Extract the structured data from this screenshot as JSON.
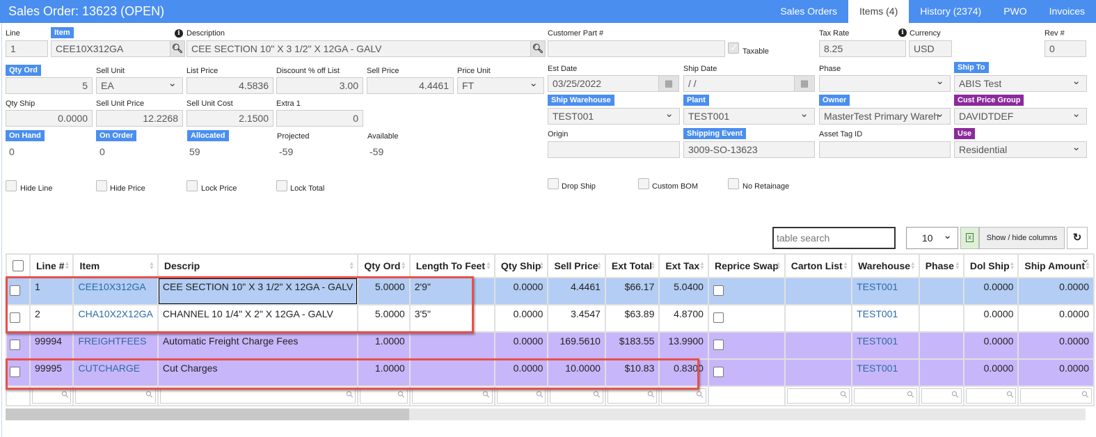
{
  "header": {
    "title": "Sales Order: 13623 (OPEN)",
    "tabs": [
      {
        "label": "Sales Orders",
        "active": false
      },
      {
        "label": "Items (4)",
        "active": true
      },
      {
        "label": "History (2374)",
        "active": false
      },
      {
        "label": "PWO",
        "active": false
      },
      {
        "label": "Invoices",
        "active": false
      }
    ]
  },
  "form": {
    "line": {
      "label": "Line",
      "value": "1"
    },
    "item": {
      "label": "Item",
      "value": "CEE10X312GA"
    },
    "description": {
      "label": "Description",
      "value": "CEE SECTION  10\" X 3 1/2\" X 12GA - GALV"
    },
    "customer_part": {
      "label": "Customer Part #",
      "value": ""
    },
    "taxable": {
      "label": "Taxable",
      "checked": true
    },
    "tax_rate": {
      "label": "Tax Rate",
      "value": "8.25"
    },
    "currency": {
      "label": "Currency",
      "value": "USD"
    },
    "rev": {
      "label": "Rev #",
      "value": "0"
    },
    "qty_ord": {
      "label": "Qty Ord",
      "value": "5"
    },
    "sell_unit": {
      "label": "Sell Unit",
      "value": "EA"
    },
    "list_price": {
      "label": "List Price",
      "value": "4.5836"
    },
    "discount": {
      "label": "Discount % off List",
      "value": "3.00"
    },
    "sell_price": {
      "label": "Sell Price",
      "value": "4.4461"
    },
    "price_unit": {
      "label": "Price Unit",
      "value": "FT"
    },
    "est_date": {
      "label": "Est Date",
      "value": "03/25/2022"
    },
    "ship_date": {
      "label": "Ship Date",
      "value": " /  /"
    },
    "phase": {
      "label": "Phase",
      "value": ""
    },
    "ship_to": {
      "label": "Ship To",
      "value": "ABIS Test"
    },
    "qty_ship": {
      "label": "Qty Ship",
      "value": "0.0000"
    },
    "sell_unit_price": {
      "label": "Sell Unit Price",
      "value": "12.2268"
    },
    "sell_unit_cost": {
      "label": "Sell Unit Cost",
      "value": "2.1500"
    },
    "extra1": {
      "label": "Extra 1",
      "value": "0"
    },
    "ship_warehouse": {
      "label": "Ship Warehouse",
      "value": "TEST001"
    },
    "plant": {
      "label": "Plant",
      "value": "TEST001"
    },
    "owner": {
      "label": "Owner",
      "value": "MasterTest Primary Wareh"
    },
    "cust_price_group": {
      "label": "Cust Price Group",
      "value": "DAVIDTDEF"
    },
    "on_hand": {
      "label": "On Hand",
      "value": "0"
    },
    "on_order": {
      "label": "On Order",
      "value": "0"
    },
    "allocated": {
      "label": "Allocated",
      "value": "59"
    },
    "projected": {
      "label": "Projected",
      "value": "-59"
    },
    "available": {
      "label": "Available",
      "value": "-59"
    },
    "origin": {
      "label": "Origin",
      "value": ""
    },
    "shipping_event": {
      "label": "Shipping Event",
      "value": "3009-SO-13623"
    },
    "asset_tag": {
      "label": "Asset Tag ID",
      "value": ""
    },
    "use": {
      "label": "Use",
      "value": "Residential"
    },
    "checkboxes": [
      {
        "label": "Hide Line",
        "checked": false
      },
      {
        "label": "Hide Price",
        "checked": false
      },
      {
        "label": "Lock Price",
        "checked": false
      },
      {
        "label": "Lock Total",
        "checked": false
      },
      {
        "label": "Drop Ship",
        "checked": false
      },
      {
        "label": "Custom BOM",
        "checked": false
      },
      {
        "label": "No Retainage",
        "checked": false
      }
    ]
  },
  "table_tools": {
    "search_placeholder": "table search",
    "page_size": "10",
    "excel_icon": "x",
    "show_hide_label": "Show / hide columns",
    "reset_icon": "↻"
  },
  "table": {
    "columns": [
      "Line #",
      "Item",
      "Descrip",
      "Qty Ord",
      "Length To Feet",
      "Qty Ship",
      "Sell Price",
      "Ext Total",
      "Ext Tax",
      "Reprice Swap",
      "Carton List",
      "Warehouse",
      "Phase",
      "Dol Ship",
      "Ship Amount"
    ],
    "rows": [
      {
        "line": "1",
        "item": "CEE10X312GA",
        "descrip": "CEE SECTION 10\" X 3 1/2\" X 12GA - GALV",
        "qty_ord": "5.0000",
        "length": "2'9\"",
        "qty_ship": "0.0000",
        "sell_price": "4.4461",
        "ext_total": "$66.17",
        "ext_tax": "5.0400",
        "carton": "",
        "warehouse": "TEST001",
        "phase": "",
        "dol_ship": "0.0000",
        "ship_amount": "0.0000",
        "style": "sel"
      },
      {
        "line": "2",
        "item": "CHA10X2X12GA",
        "descrip": "CHANNEL 10 1/4\" X 2\" X 12GA - GALV",
        "qty_ord": "5.0000",
        "length": "3'5\"",
        "qty_ship": "0.0000",
        "sell_price": "3.4547",
        "ext_total": "$63.89",
        "ext_tax": "4.8700",
        "carton": "",
        "warehouse": "TEST001",
        "phase": "",
        "dol_ship": "0.0000",
        "ship_amount": "0.0000",
        "style": "plain"
      },
      {
        "line": "99994",
        "item": "FREIGHTFEES",
        "descrip": "Automatic Freight Charge Fees",
        "qty_ord": "1.0000",
        "length": "",
        "qty_ship": "0.0000",
        "sell_price": "169.5610",
        "ext_total": "$183.55",
        "ext_tax": "13.9900",
        "carton": "",
        "warehouse": "TEST001",
        "phase": "",
        "dol_ship": "0.0000",
        "ship_amount": "0.0000",
        "style": "purple"
      },
      {
        "line": "99995",
        "item": "CUTCHARGE",
        "descrip": "Cut Charges",
        "qty_ord": "1.0000",
        "length": "",
        "qty_ship": "0.0000",
        "sell_price": "10.0000",
        "ext_total": "$10.83",
        "ext_tax": "0.8300",
        "carton": "",
        "warehouse": "TEST001",
        "phase": "",
        "dol_ship": "0.0000",
        "ship_amount": "0.0000",
        "style": "purple"
      }
    ]
  }
}
